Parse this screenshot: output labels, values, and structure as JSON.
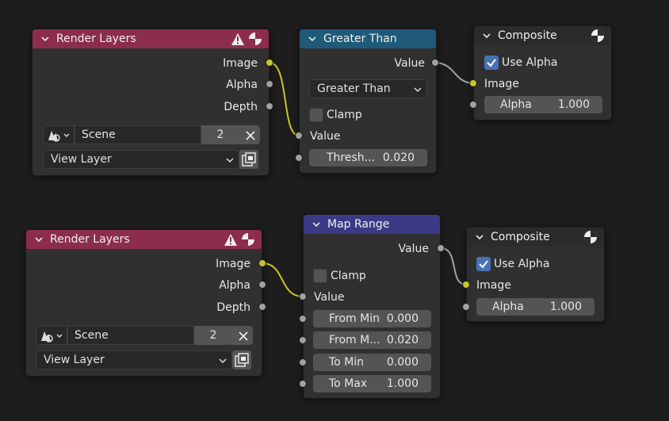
{
  "nodes": {
    "render_layers_1": {
      "title": "Render Layers",
      "outputs": [
        "Image",
        "Alpha",
        "Depth"
      ],
      "scene_label": "Scene",
      "scene_users": "2",
      "view_layer": "View Layer",
      "icons": [
        "warning-icon",
        "render-icon"
      ]
    },
    "greater_than": {
      "title": "Greater Than",
      "output": "Value",
      "operation": "Greater Than",
      "clamp_label": "Clamp",
      "clamp_checked": false,
      "input_value": "Value",
      "threshold_label": "Thresh...",
      "threshold_value": "0.020"
    },
    "composite_1": {
      "title": "Composite",
      "use_alpha_label": "Use Alpha",
      "use_alpha_checked": true,
      "input_image": "Image",
      "alpha_label": "Alpha",
      "alpha_value": "1.000"
    },
    "render_layers_2": {
      "title": "Render Layers",
      "outputs": [
        "Image",
        "Alpha",
        "Depth"
      ],
      "scene_label": "Scene",
      "scene_users": "2",
      "view_layer": "View Layer"
    },
    "map_range": {
      "title": "Map Range",
      "output": "Value",
      "clamp_label": "Clamp",
      "clamp_checked": false,
      "input_value": "Value",
      "fields": [
        {
          "label": "From Min",
          "value": "0.000"
        },
        {
          "label": "From M...",
          "value": "0.020"
        },
        {
          "label": "To Min",
          "value": "0.000"
        },
        {
          "label": "To Max",
          "value": "1.000"
        }
      ]
    },
    "composite_2": {
      "title": "Composite",
      "use_alpha_label": "Use Alpha",
      "use_alpha_checked": true,
      "input_image": "Image",
      "alpha_label": "Alpha",
      "alpha_value": "1.000"
    }
  },
  "colors": {
    "background": "#1d1d1d",
    "node_body": "#303030",
    "render_layers_header": "#8c2d4b",
    "math_header": "#1f5a78",
    "map_range_header": "#3c3a86",
    "composite_header": "#2b2b2b",
    "color_socket": "#c7c729",
    "value_socket": "#a1a1a1"
  }
}
